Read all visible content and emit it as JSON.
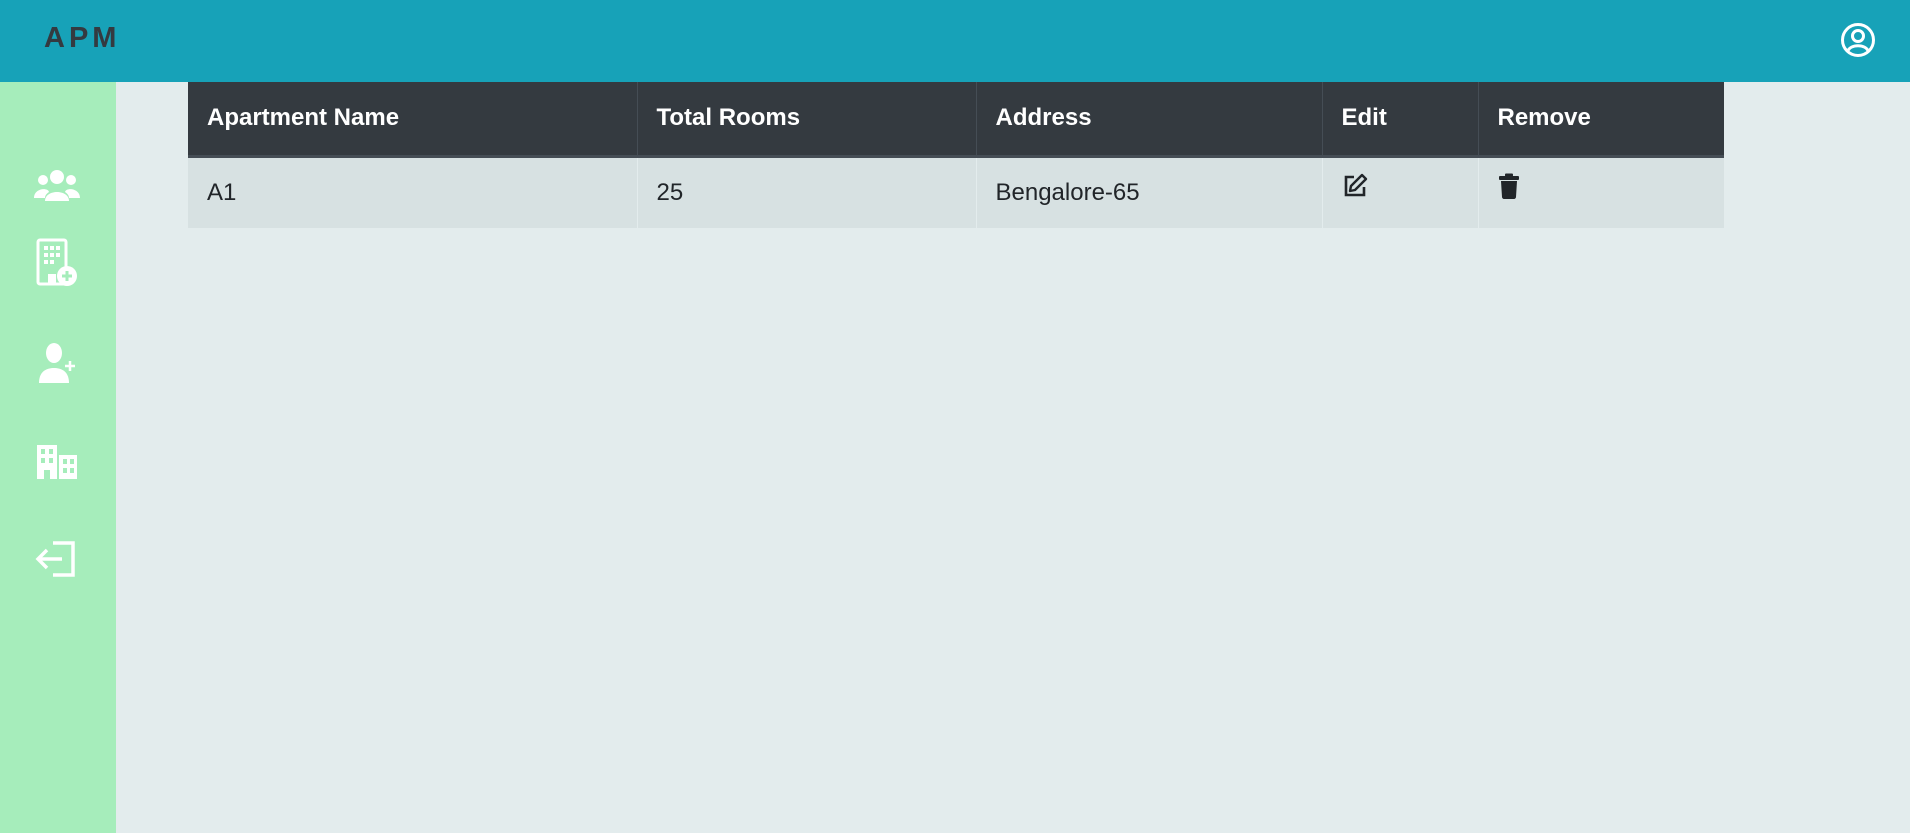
{
  "header": {
    "brand": "APM",
    "user_icon": "user-circle-icon"
  },
  "sidebar": {
    "items": [
      {
        "name": "users-group",
        "icon": "users-icon"
      },
      {
        "name": "add-building",
        "icon": "building-add-icon"
      },
      {
        "name": "add-user",
        "icon": "user-add-icon"
      },
      {
        "name": "apartments",
        "icon": "city-buildings-icon"
      },
      {
        "name": "logout",
        "icon": "logout-icon"
      }
    ]
  },
  "table": {
    "columns": [
      "Apartment Name",
      "Total Rooms",
      "Address",
      "Edit",
      "Remove"
    ],
    "rows": [
      {
        "apartment_name": "A1",
        "total_rooms": "25",
        "address": "Bengalore-65",
        "edit_icon": "edit-icon",
        "remove_icon": "trash-icon"
      }
    ]
  },
  "colors": {
    "topbar": "#17a2b8",
    "sidebar": "#a6edbb",
    "table_header": "#343a40",
    "background": "#e3eced"
  }
}
